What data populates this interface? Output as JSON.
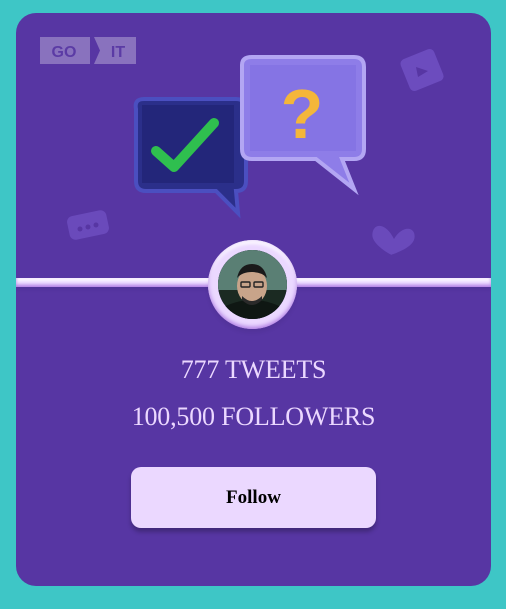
{
  "card": {
    "logo": {
      "left_text": "GO",
      "right_text": "IT"
    },
    "tweets_label": "777 TWEETS",
    "followers_label": "100,500 FOLLOWERS",
    "follow_button_label": "Follow",
    "hero": {
      "question_mark": "?"
    }
  },
  "colors": {
    "page_background": "#3ec6c6",
    "card_background": "#5736a3",
    "accent_light": "#ebd8ff",
    "check_green": "#2fbf4f",
    "question_yellow": "#f4b63a"
  }
}
